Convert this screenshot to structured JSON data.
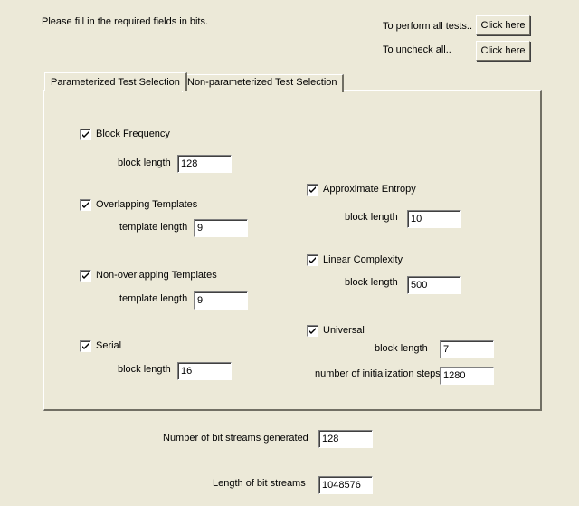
{
  "header": {
    "instruction": "Please fill in the required fields in bits.",
    "perform_all_label": "To perform all tests..",
    "perform_all_button": "Click here",
    "uncheck_all_label": "To uncheck all..",
    "uncheck_all_button": "Click here"
  },
  "tabs": [
    {
      "label": "Parameterized Test Selection",
      "active": true
    },
    {
      "label": "Non-parameterized Test Selection",
      "active": false
    }
  ],
  "tests": {
    "block_frequency": {
      "label": "Block Frequency",
      "checked": true,
      "param_label": "block length",
      "value": "128"
    },
    "overlapping_templates": {
      "label": "Overlapping Templates",
      "checked": true,
      "param_label": "template length",
      "value": "9"
    },
    "non_overlapping_templates": {
      "label": "Non-overlapping Templates",
      "checked": true,
      "param_label": "template length",
      "value": "9"
    },
    "serial": {
      "label": "Serial",
      "checked": true,
      "param_label": "block length",
      "value": "16"
    },
    "approximate_entropy": {
      "label": "Approximate Entropy",
      "checked": true,
      "param_label": "block length",
      "value": "10"
    },
    "linear_complexity": {
      "label": "Linear Complexity",
      "checked": true,
      "param_label": "block length",
      "value": "500"
    },
    "universal": {
      "label": "Universal",
      "checked": true,
      "param_label": "block length",
      "value": "7",
      "param2_label": "number of initialization steps",
      "value2": "1280"
    }
  },
  "footer": {
    "num_streams_label": "Number of bit streams generated",
    "num_streams_value": "128",
    "stream_length_label": "Length of bit streams",
    "stream_length_value": "1048576"
  }
}
